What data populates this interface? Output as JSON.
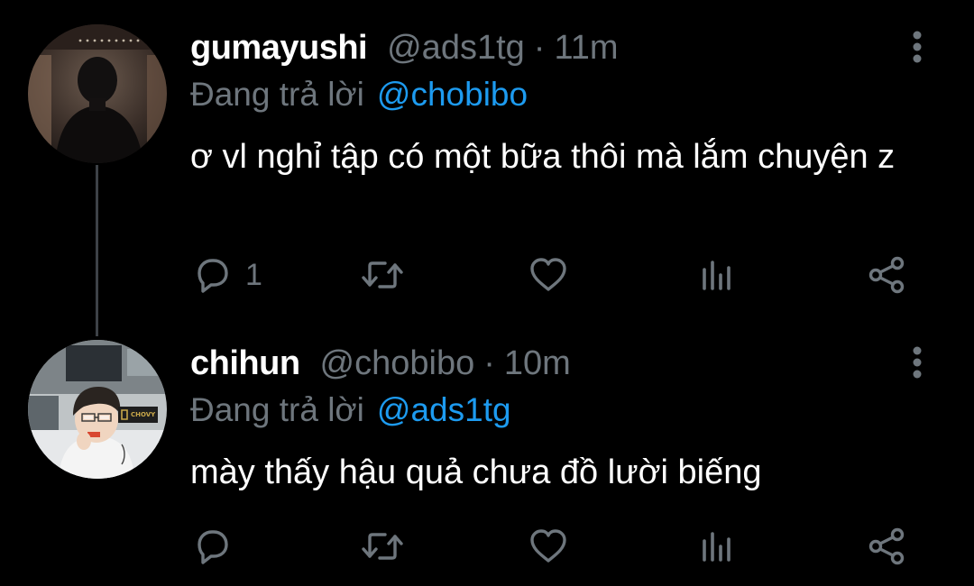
{
  "tweets": [
    {
      "display_name": "gumayushi",
      "handle": "@ads1tg",
      "separator": "·",
      "time": "11m",
      "reply_prefix": "Đang trả lời",
      "reply_to": "@chobibo",
      "text": "ơ vl nghỉ tập có một bữa thôi mà lắm chuyện z",
      "reply_count": "1",
      "avatar": "dark-suited-person-photo"
    },
    {
      "display_name": "chihun",
      "handle": "@chobibo",
      "separator": "·",
      "time": "10m",
      "reply_prefix": "Đang trả lời",
      "reply_to": "@ads1tg",
      "text": "mày thấy hậu quả chưa đồ lười biếng",
      "reply_count": "",
      "avatar": "stream-webcam-photo",
      "avatar_badge": "CHOVY"
    }
  ],
  "icons": {
    "reply": "reply-icon",
    "retweet": "retweet-icon",
    "like": "heart-icon",
    "views": "views-icon",
    "share": "share-icon",
    "more": "more-vertical-icon"
  },
  "colors": {
    "background": "#000000",
    "primary_text": "#ffffff",
    "secondary_text": "#6e767d",
    "link": "#1d9bf0",
    "thread_line": "#3d4247"
  }
}
